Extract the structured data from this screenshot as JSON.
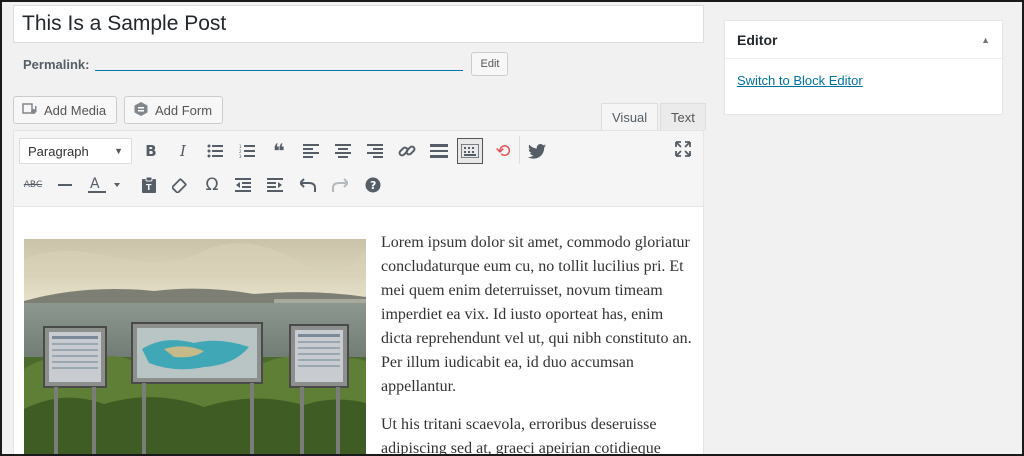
{
  "post": {
    "title": "This Is a Sample Post",
    "permalink_label": "Permalink:",
    "permalink_url": "",
    "edit_label": "Edit"
  },
  "media_buttons": {
    "add_media": "Add Media",
    "add_form": "Add Form"
  },
  "tabs": {
    "visual": "Visual",
    "text": "Text"
  },
  "toolbar": {
    "format_value": "Paragraph",
    "row1": [
      "bold-icon",
      "italic-icon",
      "bulleted-list-icon",
      "numbered-list-icon",
      "blockquote-icon",
      "align-left-icon",
      "align-center-icon",
      "align-right-icon",
      "link-icon",
      "read-more-icon",
      "toolbar-toggle-icon",
      "unlink-icon",
      "twitter-icon",
      "fullscreen-icon"
    ],
    "row2": [
      "strikethrough-icon",
      "horizontal-rule-icon",
      "text-color-icon",
      "paste-text-icon",
      "clear-formatting-icon",
      "special-character-icon",
      "outdent-icon",
      "indent-icon",
      "undo-icon",
      "redo-icon",
      "help-icon"
    ],
    "glyphs": {
      "bold": "B",
      "italic": "I",
      "ul": "☰",
      "ol": "≡",
      "quote": "❝",
      "align_left": "≡",
      "align_center": "≡",
      "align_right": "≡",
      "link": "🔗",
      "more": "▬",
      "kitchen": "▦",
      "unlink": "⟲",
      "twitter": "🐦",
      "fullscreen": "⤢",
      "strike": "ABC",
      "hr": "—",
      "color": "A",
      "paste": "📋",
      "eraser": "⌫",
      "omega": "Ω",
      "outdent": "⇤",
      "indent": "⇥",
      "undo": "↶",
      "redo": "↷",
      "help": "?"
    }
  },
  "content": {
    "paragraph1": "Lorem ipsum dolor sit amet, commodo gloriatur concludaturque eum cu, no tollit lucilius pri. Et mei quem enim deterruisset, novum timeam imperdiet ea vix. Id iusto oporteat has, enim dicta reprehendunt vel ut, qui nibh constituto an. Per illum iudicabit ea, id duo accumsan appellantur.",
    "paragraph2": "Ut his tritani scaevola, erroribus deseruisse adipiscing sed at, graeci apeirian cotidieque"
  },
  "sidebar": {
    "editor_heading": "Editor",
    "switch_link": "Switch to Block Editor"
  }
}
